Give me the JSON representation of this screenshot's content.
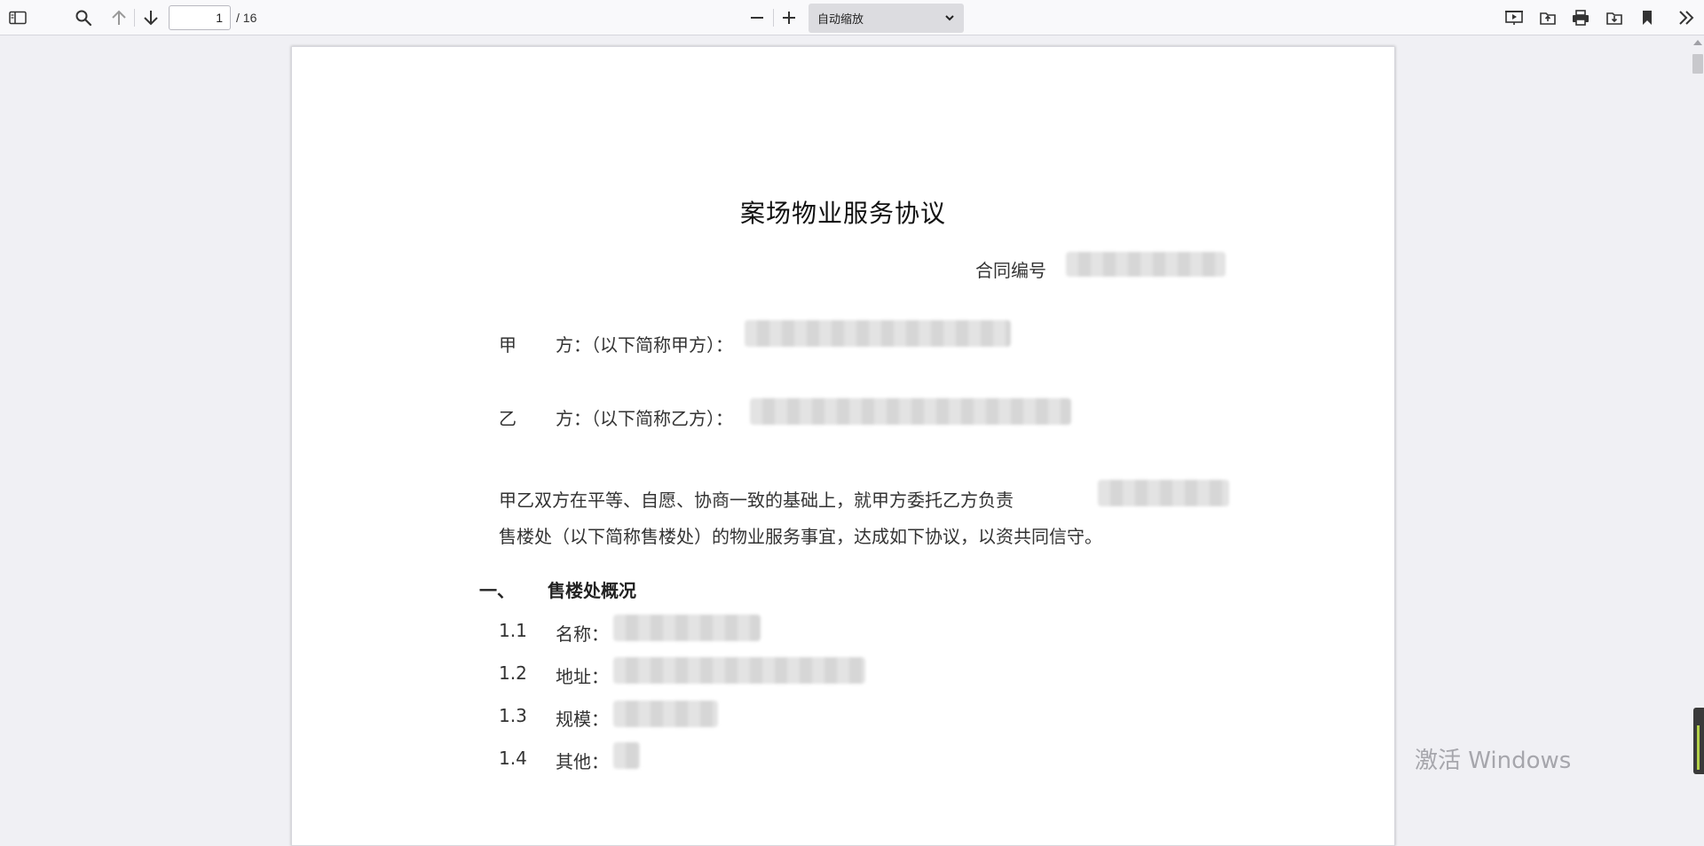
{
  "toolbar": {
    "page_current": "1",
    "page_total": "/ 16",
    "zoom_label": "自动缩放",
    "icons": [
      "sidebar-toggle-icon",
      "search-icon",
      "arrow-up-icon",
      "arrow-down-icon",
      "minus-icon",
      "plus-icon",
      "chevron-down-icon",
      "presentation-icon",
      "open-file-icon",
      "print-icon",
      "download-icon",
      "bookmark-icon",
      "double-chevron-right-icon"
    ]
  },
  "document": {
    "title": "案场物业服务协议",
    "contract_no_label": "合同编号",
    "party_a_char": "甲",
    "party_a_label": "方：（以下简称甲方）：",
    "party_b_char": "乙",
    "party_b_label": "方：（以下简称乙方）：",
    "intro_line1": "甲乙双方在平等、自愿、协商一致的基础上，就甲方委托乙方负责",
    "intro_line2": "售楼处（以下简称售楼处）的物业服务事宜，达成如下协议，以资共同信守。",
    "section1_num": "一、",
    "section1_title": "售楼处概况",
    "items": [
      {
        "num": "1.1",
        "label": "名称："
      },
      {
        "num": "1.2",
        "label": "地址："
      },
      {
        "num": "1.3",
        "label": "规模："
      },
      {
        "num": "1.4",
        "label": "其他："
      }
    ]
  },
  "watermark": "激活 Windows"
}
